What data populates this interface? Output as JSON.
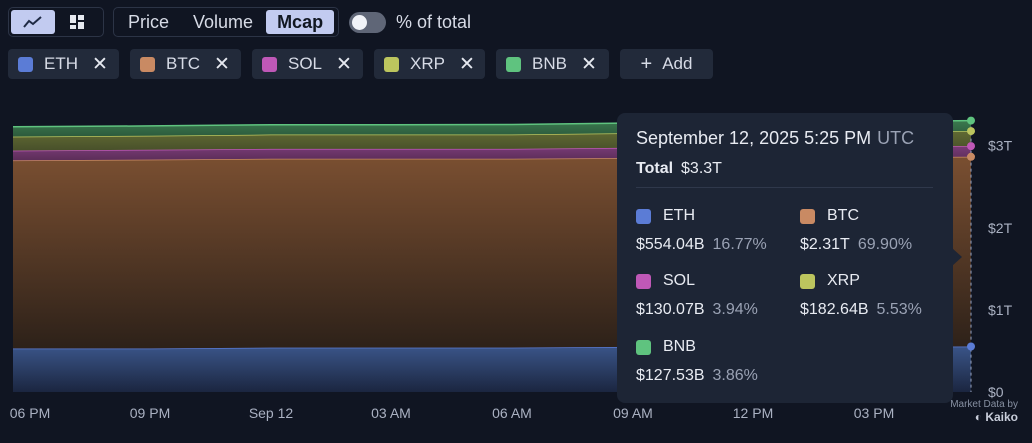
{
  "toolbar": {
    "view_icons": [
      "line-chart-icon",
      "grid-icon"
    ],
    "metrics": [
      {
        "label": "Price",
        "active": false
      },
      {
        "label": "Volume",
        "active": false
      },
      {
        "label": "Mcap",
        "active": true
      }
    ],
    "percent_toggle_label": "% of total",
    "percent_toggle_on": false
  },
  "series_chips": [
    {
      "label": "ETH",
      "color": "#5b7cd6"
    },
    {
      "label": "BTC",
      "color": "#c98a63"
    },
    {
      "label": "SOL",
      "color": "#bf58b7"
    },
    {
      "label": "XRP",
      "color": "#bcc55e"
    },
    {
      "label": "BNB",
      "color": "#5fc37f"
    }
  ],
  "add_label": "Add",
  "chart_data": {
    "type": "area",
    "stacked": true,
    "x": [
      "06 PM",
      "09 PM",
      "Sep 12",
      "03 AM",
      "06 AM",
      "09 AM",
      "12 PM",
      "03 PM",
      "5:25 PM"
    ],
    "series": [
      {
        "name": "ETH",
        "color": "#5b7cd6",
        "values": [
          0.53,
          0.53,
          0.54,
          0.54,
          0.54,
          0.55,
          0.55,
          0.55,
          0.554
        ]
      },
      {
        "name": "BTC",
        "color": "#c98a63",
        "values": [
          2.29,
          2.3,
          2.3,
          2.3,
          2.3,
          2.3,
          2.31,
          2.31,
          2.31
        ]
      },
      {
        "name": "SOL",
        "color": "#bf58b7",
        "values": [
          0.12,
          0.12,
          0.12,
          0.12,
          0.12,
          0.125,
          0.127,
          0.128,
          0.13
        ]
      },
      {
        "name": "XRP",
        "color": "#bcc55e",
        "values": [
          0.17,
          0.17,
          0.175,
          0.175,
          0.176,
          0.177,
          0.179,
          0.18,
          0.183
        ]
      },
      {
        "name": "BNB",
        "color": "#5fc37f",
        "values": [
          0.12,
          0.12,
          0.12,
          0.12,
          0.122,
          0.123,
          0.125,
          0.126,
          0.128
        ]
      }
    ],
    "y_ticks": [
      "$0",
      "$1T",
      "$2T",
      "$3T"
    ],
    "x_ticks": [
      "06 PM",
      "09 PM",
      "Sep 12",
      "03 AM",
      "06 AM",
      "09 AM",
      "12 PM",
      "03 PM"
    ],
    "ylim": [
      0,
      3.3
    ],
    "legend": "top",
    "grid": false
  },
  "tooltip": {
    "date": "September 12, 2025 5:25 PM",
    "tz": "UTC",
    "total_label": "Total",
    "total_value": "$3.3T",
    "items": [
      {
        "name": "ETH",
        "color": "#5b7cd6",
        "value": "$554.04B",
        "pct": "16.77%"
      },
      {
        "name": "BTC",
        "color": "#c98a63",
        "value": "$2.31T",
        "pct": "69.90%"
      },
      {
        "name": "SOL",
        "color": "#bf58b7",
        "value": "$130.07B",
        "pct": "3.94%"
      },
      {
        "name": "XRP",
        "color": "#bcc55e",
        "value": "$182.64B",
        "pct": "5.53%"
      },
      {
        "name": "BNB",
        "color": "#5fc37f",
        "value": "$127.53B",
        "pct": "3.86%"
      }
    ]
  },
  "attribution": {
    "line1": "Market Data by",
    "brand": "Kaiko"
  }
}
